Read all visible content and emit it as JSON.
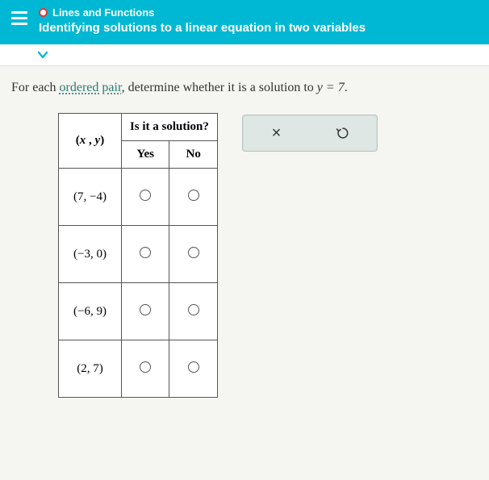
{
  "header": {
    "breadcrumb": "Lines and Functions",
    "title": "Identifying solutions to a linear equation in two variables"
  },
  "prompt": {
    "prefix": "For each ",
    "link": "ordered pair",
    "middle": ", determine whether it is a solution to ",
    "equation": "y = 7",
    "suffix": "."
  },
  "table": {
    "question_header": "Is it a solution?",
    "pair_header": "(x , y)",
    "yes_label": "Yes",
    "no_label": "No",
    "rows": [
      {
        "pair": "(7, −4)"
      },
      {
        "pair": "(−3, 0)"
      },
      {
        "pair": "(−6, 9)"
      },
      {
        "pair": "(2, 7)"
      }
    ]
  },
  "actions": {
    "close": "×",
    "reset": "↺"
  },
  "chart_data": {
    "type": "table",
    "title": "Is it a solution?",
    "equation": "y = 7",
    "columns": [
      "(x, y)",
      "Yes",
      "No"
    ],
    "rows": [
      {
        "pair": "(7, -4)",
        "yes": null,
        "no": null
      },
      {
        "pair": "(-3, 0)",
        "yes": null,
        "no": null
      },
      {
        "pair": "(-6, 9)",
        "yes": null,
        "no": null
      },
      {
        "pair": "(2, 7)",
        "yes": null,
        "no": null
      }
    ]
  }
}
